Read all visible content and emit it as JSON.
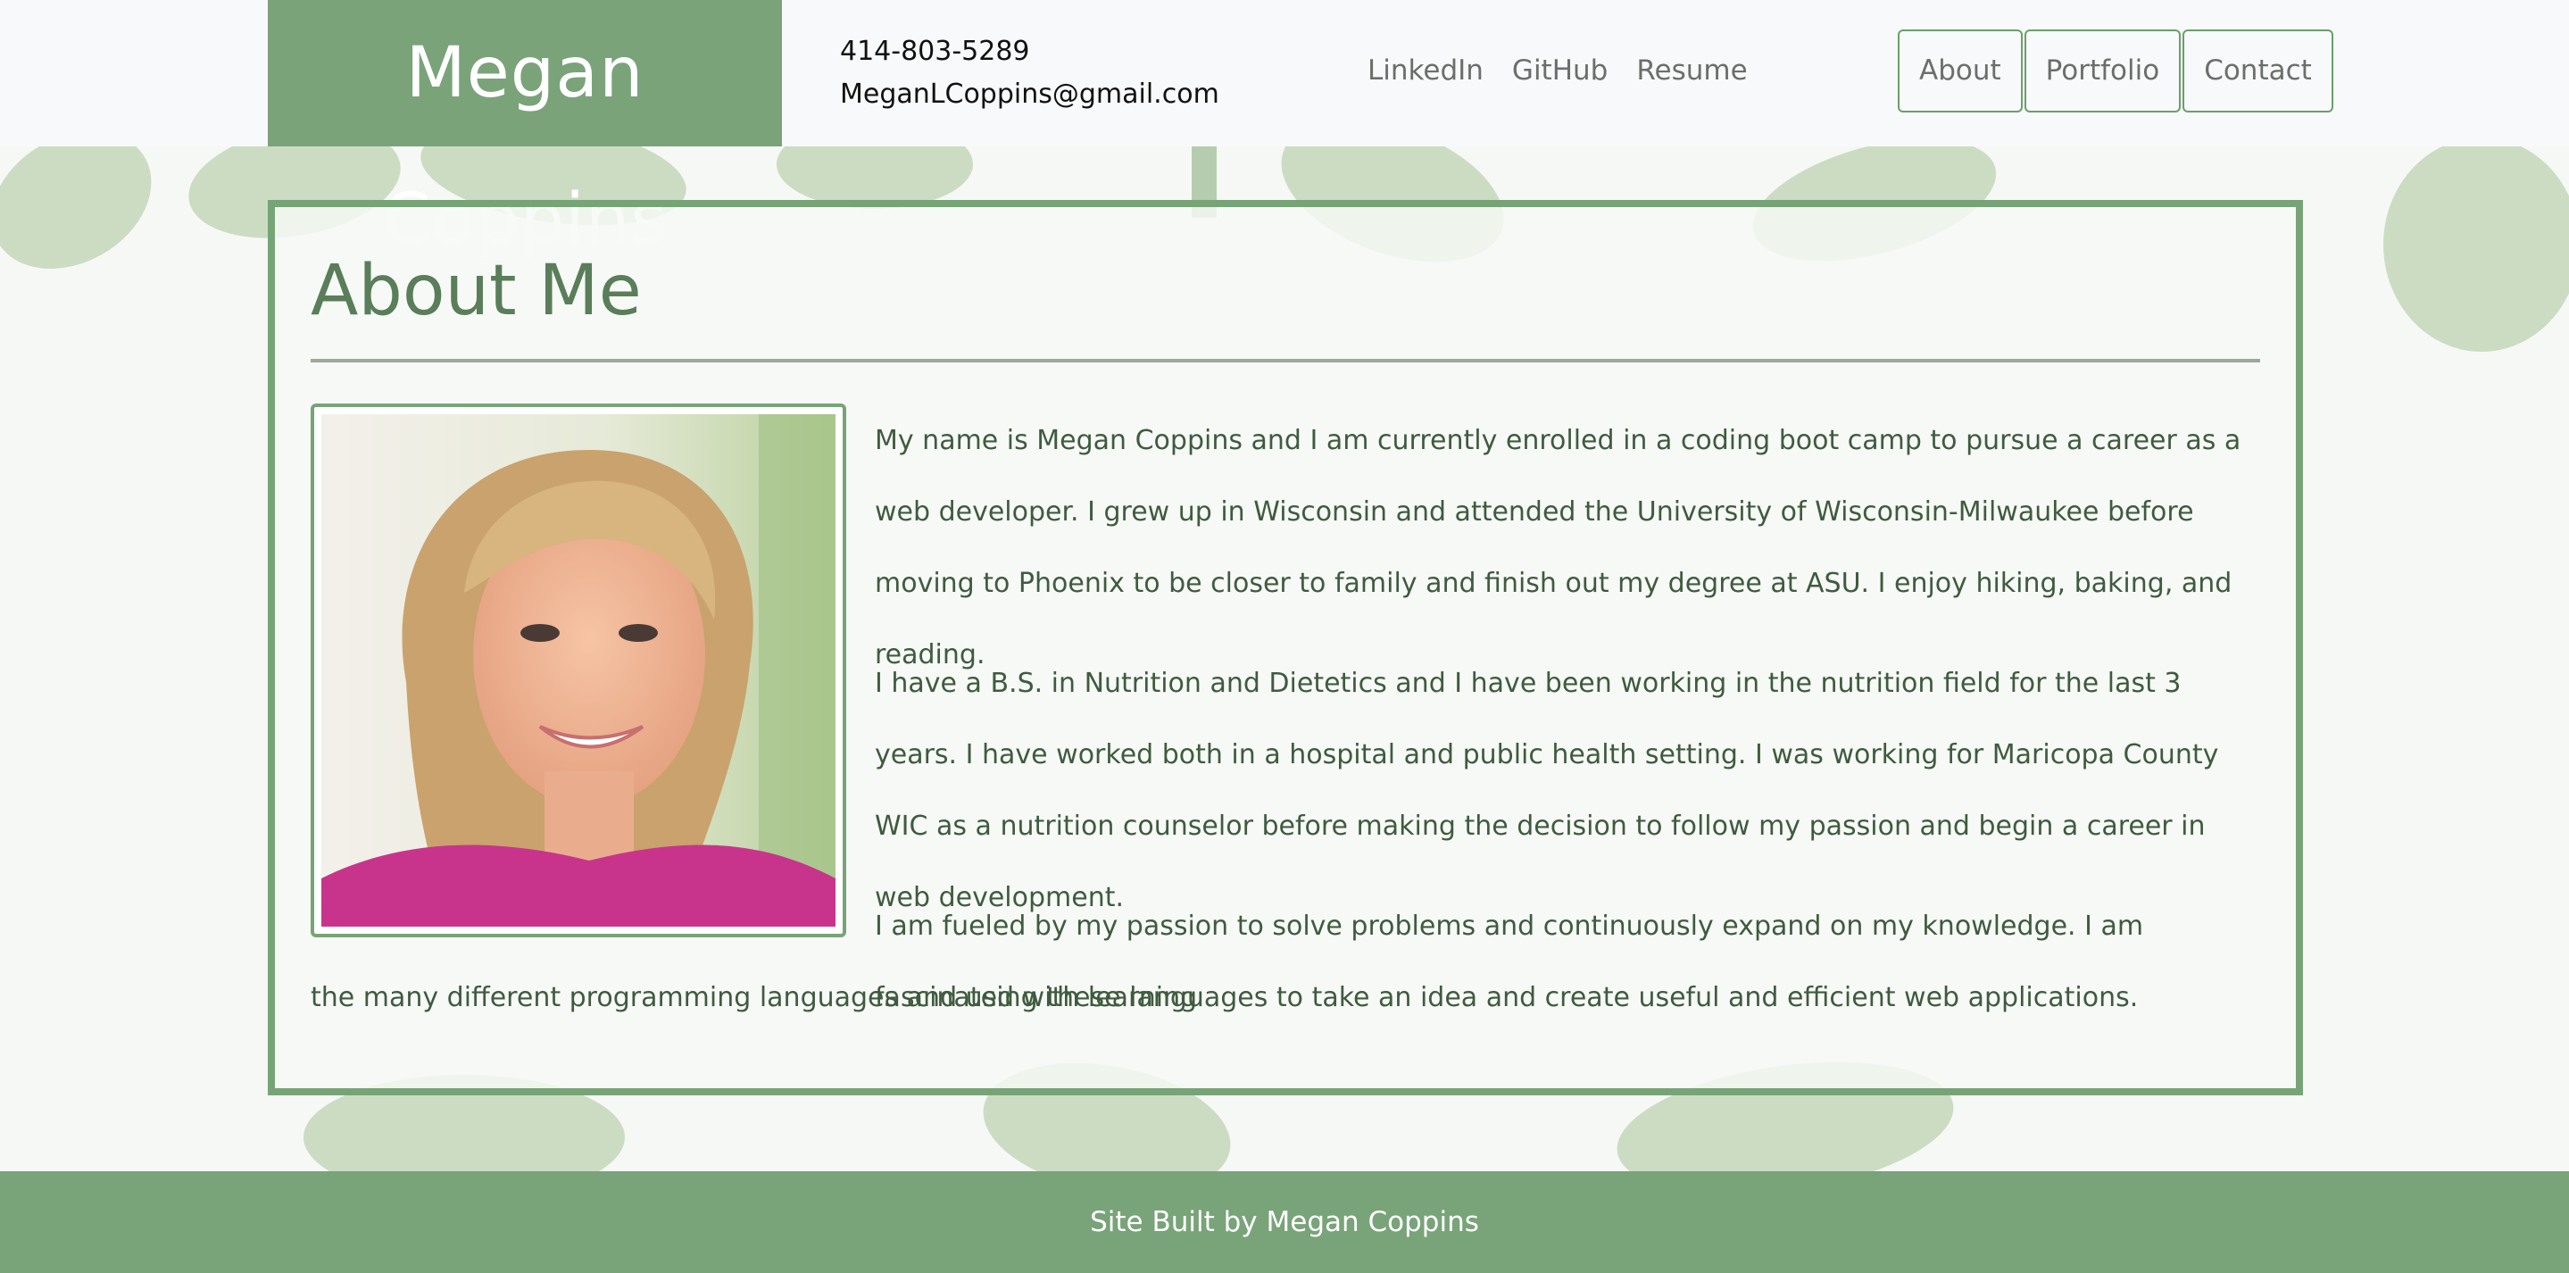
{
  "header": {
    "brand": "Megan Coppins",
    "phone": "414-803-5289",
    "email": "MeganLCoppins@gmail.com",
    "external_links": [
      {
        "label": "LinkedIn"
      },
      {
        "label": "GitHub"
      },
      {
        "label": "Resume"
      }
    ],
    "nav": [
      {
        "label": "About"
      },
      {
        "label": "Portfolio"
      },
      {
        "label": "Contact"
      }
    ]
  },
  "about": {
    "title": "About Me",
    "paragraph_1": "My name is Megan Coppins and I am currently enrolled in a coding boot camp to pursue a career as a web developer. I grew up in Wisconsin and attended the University of Wisconsin-Milwaukee before moving to Phoenix to be closer to family and finish out my degree at ASU. I enjoy hiking, baking, and reading.",
    "paragraph_2": "I have a B.S. in Nutrition and Dietetics and I have been working in the nutrition field for the last 3 years. I have worked both in a hospital and public health setting. I was working for Maricopa County WIC as a nutrition counselor before making the decision to follow my passion and begin a career in web development.",
    "paragraph_3a": "I am fueled by my passion to solve problems and continuously expand on my knowledge. I am fascinated with learning",
    "paragraph_3b": "the many different programming languages and using these languages to take an idea and create useful and efficient web applications."
  },
  "footer": {
    "text": "Site Built by Megan Coppins"
  },
  "colors": {
    "brand_green": "#7aa37a",
    "border_green": "#77a477",
    "text_green": "#3f5b3f",
    "title_green": "#5a7d5a"
  }
}
